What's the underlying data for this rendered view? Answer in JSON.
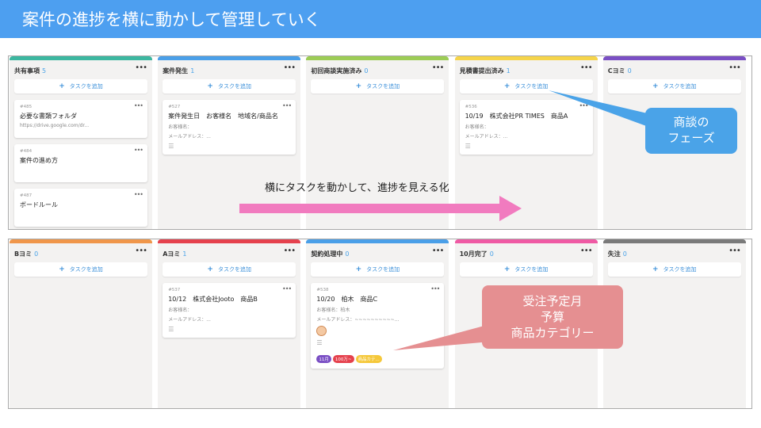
{
  "header": {
    "title": "案件の進捗を横に動かして管理していく"
  },
  "add_task_label": "タスクを追加",
  "board_top": {
    "columns": [
      {
        "name": "共有事項",
        "count": "5",
        "color": "#3cb7a0",
        "cards": [
          {
            "id": "#485",
            "title": "必要な書類フォルダ",
            "lines": [
              "https://drive.google.com/dr..."
            ]
          },
          {
            "id": "#484",
            "title": "案件の進め方",
            "lines": []
          },
          {
            "id": "#487",
            "title": "ボードルール",
            "lines": []
          }
        ]
      },
      {
        "name": "案件発生",
        "count": "1",
        "color": "#4a9fe8",
        "cards": [
          {
            "id": "#527",
            "title": "案件発生日　お客様名　地域名/商品名",
            "lines": [
              "お客様名：",
              "メールアドレス：..."
            ],
            "icon": "☰"
          }
        ]
      },
      {
        "name": "初回商談実施済み",
        "count": "0",
        "color": "#9ccc55",
        "cards": []
      },
      {
        "name": "見積書提出済み",
        "count": "1",
        "color": "#f5d44a",
        "cards": [
          {
            "id": "#536",
            "title": "10/19　株式会社PR TIMES　商品A",
            "lines": [
              "お客様名：",
              "メールアドレス：..."
            ],
            "icon": "☰"
          }
        ]
      },
      {
        "name": "Cヨミ",
        "count": "0",
        "color": "#7a4fc4",
        "cards": []
      }
    ]
  },
  "board_bottom": {
    "columns": [
      {
        "name": "Bヨミ",
        "count": "0",
        "color": "#f0964a",
        "cards": []
      },
      {
        "name": "Aヨミ",
        "count": "1",
        "color": "#e5414d",
        "cards": [
          {
            "id": "#537",
            "title": "10/12　株式会社Jooto　商品B",
            "lines": [
              "お客様名：",
              "メールアドレス：..."
            ],
            "icon": "☰"
          }
        ]
      },
      {
        "name": "契約処理中",
        "count": "0",
        "color": "#4a9fe8",
        "cards": [
          {
            "id": "#538",
            "title": "10/20　柏木　商品C",
            "lines": [
              "お客様名：柏木",
              "メールアドレス：~~~~~~~~~~..."
            ],
            "icon": "☰",
            "avatar": true,
            "tags": [
              {
                "label": "11月",
                "color": "#7a4fc4"
              },
              {
                "label": "100万~",
                "color": "#e5414d"
              },
              {
                "label": "商品カテ...",
                "color": "#f5c83a"
              }
            ]
          }
        ]
      },
      {
        "name": "10月完了",
        "count": "0",
        "color": "#ef5aa4",
        "cards": []
      },
      {
        "name": "失注",
        "count": "0",
        "color": "#7a7a7a",
        "cards": []
      }
    ]
  },
  "overlays": {
    "progress_text": "横にタスクを動かして、進捗を見える化",
    "phase_callout": [
      "商談の",
      "フェーズ"
    ],
    "info_callout": [
      "受注予定月",
      "予算",
      "商品カテゴリー"
    ],
    "arrow_color": "#f17bbf",
    "phase_color": "#4aa3e8",
    "info_color": "#e58f91"
  }
}
